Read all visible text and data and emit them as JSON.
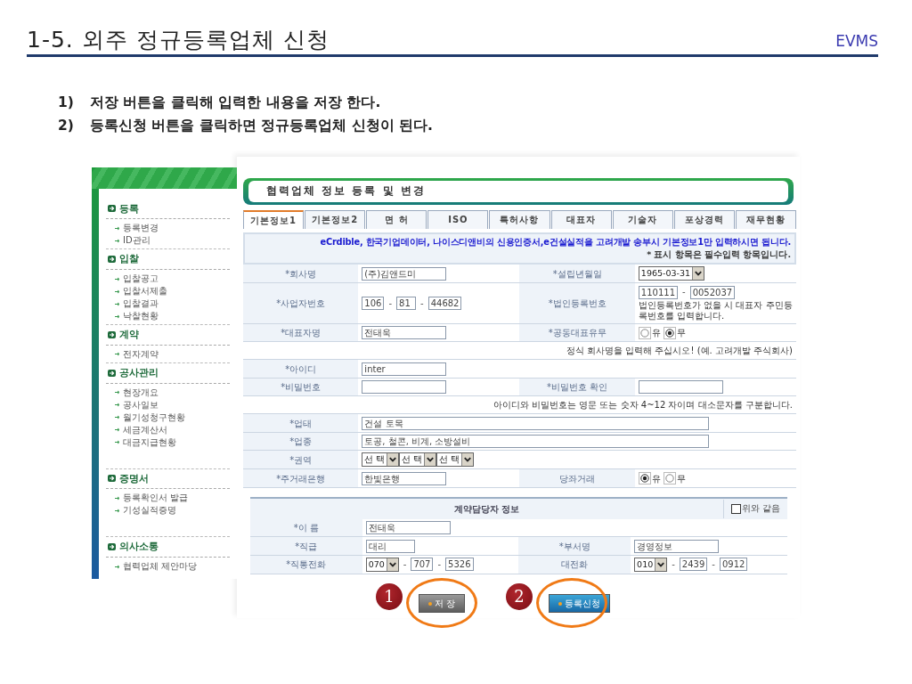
{
  "slide": {
    "title": "1-5. 외주 정규등록업체 신청",
    "brand": "EVMS",
    "steps": [
      {
        "number": "1)",
        "text": "저장 버튼을 클릭해 입력한 내용을 저장 한다."
      },
      {
        "number": "2)",
        "text": "등록신청 버튼을 클릭하면 정규등록업체 신청이 된다."
      }
    ]
  },
  "sidebar": {
    "sections": [
      {
        "title": "등록",
        "items": [
          "등록변경",
          "ID관리"
        ]
      },
      {
        "title": "입찰",
        "items": [
          "입찰공고",
          "입찰서제출",
          "입찰결과",
          "낙찰현황"
        ]
      },
      {
        "title": "계약",
        "items": [
          "전자계약"
        ]
      },
      {
        "title": "공사관리",
        "items": [
          "현장개요",
          "공사일보",
          "월기성청구현황",
          "세금계산서",
          "대금지급현황"
        ]
      },
      {
        "title": "증명서",
        "items": [
          "등록확인서 발급",
          "기성실적증명"
        ]
      },
      {
        "title": "의사소통",
        "items": [
          "협력업체 제안마당"
        ]
      }
    ]
  },
  "form": {
    "title": "협력업체 정보 등록 및 변경",
    "tabs": [
      {
        "label": "기본정보1",
        "selected": true
      },
      {
        "label": "기본정보2",
        "selected": false
      },
      {
        "label": "면 허",
        "selected": false
      },
      {
        "label": "ISO",
        "selected": false
      },
      {
        "label": "특허사항",
        "selected": false
      },
      {
        "label": "대표자",
        "selected": false
      },
      {
        "label": "기술자",
        "selected": false
      },
      {
        "label": "포상경력",
        "selected": false
      },
      {
        "label": "재무현황",
        "selected": false
      }
    ],
    "notice": "eCrdible, 한국기업데이터, 나이스디앤비의 신용인증서,e건설실적을 고려개발 송부시 기본정보1만 입력하시면 됩니다.",
    "required_note": "* 표시 항목은 필수입력 항목입니다.",
    "rows": [
      {
        "kind": "fields",
        "cells": [
          {
            "label": "*회사명",
            "controls": [
              {
                "kind": "input",
                "value": "(주)김앤드미"
              }
            ]
          },
          {
            "label": "*설립년월일",
            "controls": [
              {
                "kind": "select",
                "value": "1965-03-31"
              }
            ]
          }
        ]
      },
      {
        "kind": "fields",
        "cells": [
          {
            "label": "*사업자번호",
            "controls": [
              {
                "kind": "code",
                "value": "106"
              },
              {
                "kind": "sep",
                "value": "-"
              },
              {
                "kind": "code",
                "value": "81"
              },
              {
                "kind": "sep",
                "value": "-"
              },
              {
                "kind": "code",
                "value": "44682"
              }
            ]
          },
          {
            "label": "*법인등록번호",
            "controls": [
              {
                "kind": "code",
                "value": "110111"
              },
              {
                "kind": "sep",
                "value": "-"
              },
              {
                "kind": "code",
                "value": "0052037"
              },
              {
                "kind": "text",
                "value": "법인등록번호가 없을 시 대표자 주민등록번호를 입력합니다."
              }
            ]
          }
        ]
      },
      {
        "kind": "fields",
        "cells": [
          {
            "label": "*대표자명",
            "controls": [
              {
                "kind": "input",
                "value": "전태욱"
              }
            ]
          },
          {
            "label": "*공동대표유무",
            "controls": [
              {
                "kind": "radio",
                "value": "유",
                "checked": false
              },
              {
                "kind": "radio",
                "value": "무",
                "checked": true
              }
            ]
          }
        ]
      },
      {
        "kind": "note",
        "text": "정식 회사명을 입력해 주십시오! (예. 고려개발 주식회사)"
      },
      {
        "kind": "fields",
        "cells": [
          {
            "label": "*아이디",
            "controls": [
              {
                "kind": "input",
                "value": "inter"
              }
            ]
          }
        ]
      },
      {
        "kind": "fields",
        "cells": [
          {
            "label": "*비밀번호",
            "controls": [
              {
                "kind": "input"
              }
            ]
          },
          {
            "label": "*비밀번호 확인",
            "controls": [
              {
                "kind": "input"
              }
            ]
          }
        ]
      },
      {
        "kind": "note",
        "text": "아이디와 비밀번호는 영문 또는 숫자 4~12 자이며 대소문자를 구분합니다."
      },
      {
        "kind": "fields",
        "cells": [
          {
            "label": "*업태",
            "controls": [
              {
                "kind": "long",
                "value": "건설 토목"
              }
            ]
          }
        ]
      },
      {
        "kind": "fields",
        "cells": [
          {
            "label": "*업종",
            "controls": [
              {
                "kind": "long",
                "value": "토공, 철콘, 비계, 소방설비"
              }
            ]
          }
        ]
      },
      {
        "kind": "fields",
        "cells": [
          {
            "label": "*권역",
            "controls": [
              {
                "kind": "select",
                "value": "선 택"
              },
              {
                "kind": "select",
                "value": "선 택"
              },
              {
                "kind": "select",
                "value": "선 택"
              }
            ]
          }
        ]
      },
      {
        "kind": "fields",
        "cells": [
          {
            "label": "*주거래은행",
            "controls": [
              {
                "kind": "input",
                "value": "한빛은행"
              }
            ]
          },
          {
            "label": "당좌거래",
            "controls": [
              {
                "kind": "radio",
                "value": "유",
                "checked": true
              },
              {
                "kind": "radio",
                "value": "무",
                "checked": false
              }
            ]
          }
        ]
      }
    ]
  },
  "contact": {
    "title": "계약담당자 정보",
    "same_as_above": {
      "label": "위와 같음",
      "checked": false
    },
    "rows": [
      {
        "kind": "fields",
        "cells": [
          {
            "label": "*이 름",
            "controls": [
              {
                "kind": "input",
                "value": "전태욱"
              }
            ]
          }
        ]
      },
      {
        "kind": "fields",
        "cells": [
          {
            "label": "*직급",
            "controls": [
              {
                "kind": "short",
                "value": "대리"
              }
            ]
          },
          {
            "label": "*부서명",
            "controls": [
              {
                "kind": "input",
                "value": "경영정보"
              }
            ]
          }
        ]
      },
      {
        "kind": "fields",
        "cells": [
          {
            "label": "*직통전화",
            "controls": [
              {
                "kind": "select",
                "value": "070"
              },
              {
                "kind": "sep",
                "value": "-"
              },
              {
                "kind": "code",
                "value": "707"
              },
              {
                "kind": "sep",
                "value": "-"
              },
              {
                "kind": "code",
                "value": "5326"
              }
            ]
          },
          {
            "label": "대전화",
            "controls": [
              {
                "kind": "select",
                "value": "010"
              },
              {
                "kind": "sep",
                "value": "-"
              },
              {
                "kind": "code",
                "value": "2439"
              },
              {
                "kind": "sep",
                "value": "-"
              },
              {
                "kind": "code",
                "value": "0912"
              }
            ]
          }
        ]
      }
    ],
    "buttons": [
      {
        "label": "저 장",
        "kind": "save",
        "marker": "1"
      },
      {
        "label": "등록신청",
        "kind": "apply",
        "marker": "2"
      }
    ]
  }
}
